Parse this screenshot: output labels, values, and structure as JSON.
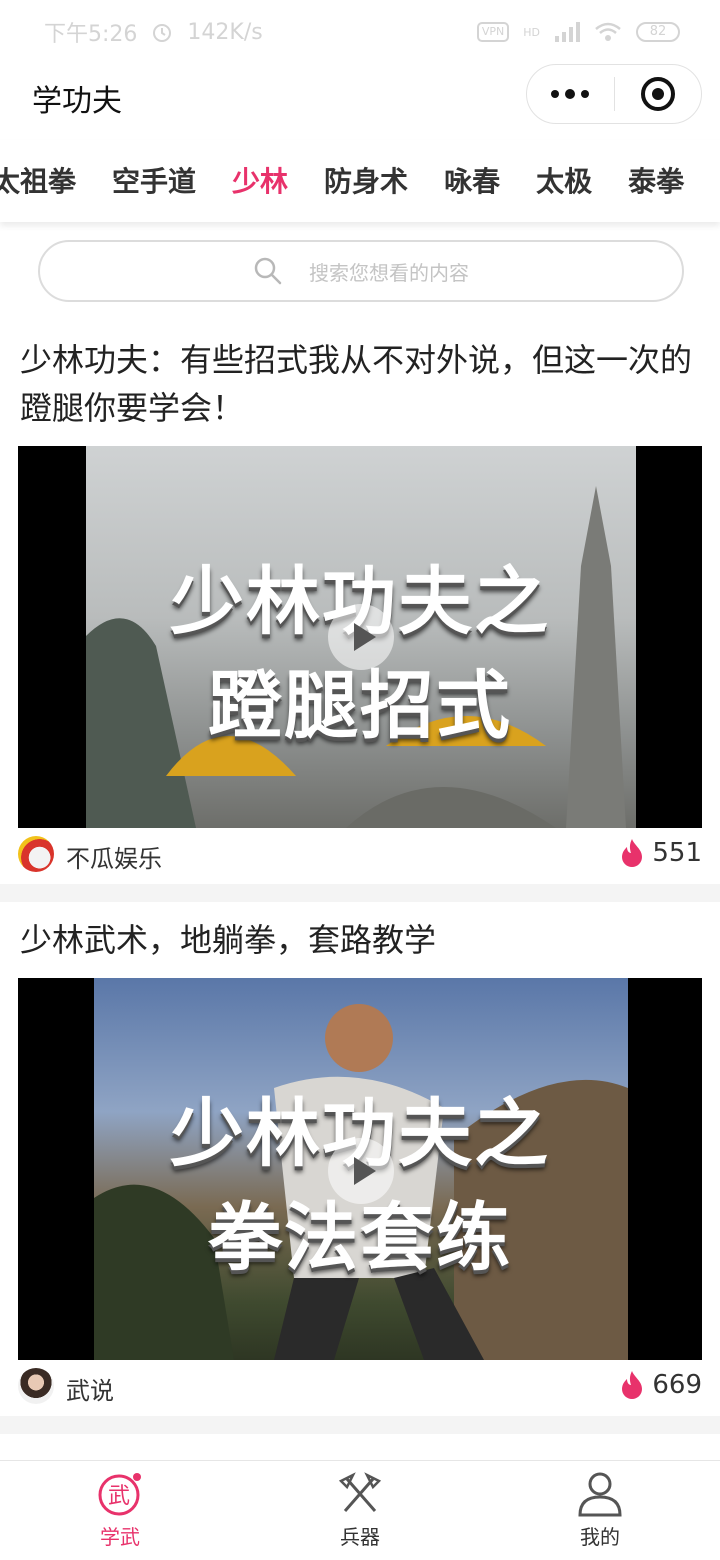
{
  "status_bar": {
    "time": "下午5:26",
    "speed": "142K/s",
    "vpn": "VPN",
    "hd": "HD",
    "battery": "82"
  },
  "app": {
    "title": "学功夫"
  },
  "tabs": [
    {
      "label": "太祖拳",
      "active": false
    },
    {
      "label": "空手道",
      "active": false
    },
    {
      "label": "少林",
      "active": true
    },
    {
      "label": "防身术",
      "active": false
    },
    {
      "label": "咏春",
      "active": false
    },
    {
      "label": "太极",
      "active": false
    },
    {
      "label": "泰拳",
      "active": false
    }
  ],
  "search": {
    "placeholder": "搜索您想看的内容"
  },
  "feed": [
    {
      "title": "少林功夫：有些招式我从不对外说，但这一次的蹬腿你要学会！",
      "thumb_line1": "少林功夫之",
      "thumb_line2": "蹬腿招式",
      "author": "不瓜娱乐",
      "likes": "551"
    },
    {
      "title": "少林武术，地躺拳，套路教学",
      "thumb_line1": "少林功夫之",
      "thumb_line2": "拳法套练",
      "author": "武说",
      "likes": "669"
    }
  ],
  "bottom_nav": [
    {
      "label": "学武",
      "icon": "wu-character-icon",
      "active": true
    },
    {
      "label": "兵器",
      "icon": "crossed-axes-icon",
      "active": false
    },
    {
      "label": "我的",
      "icon": "user-icon",
      "active": false
    }
  ],
  "colors": {
    "accent": "#e8326b"
  }
}
